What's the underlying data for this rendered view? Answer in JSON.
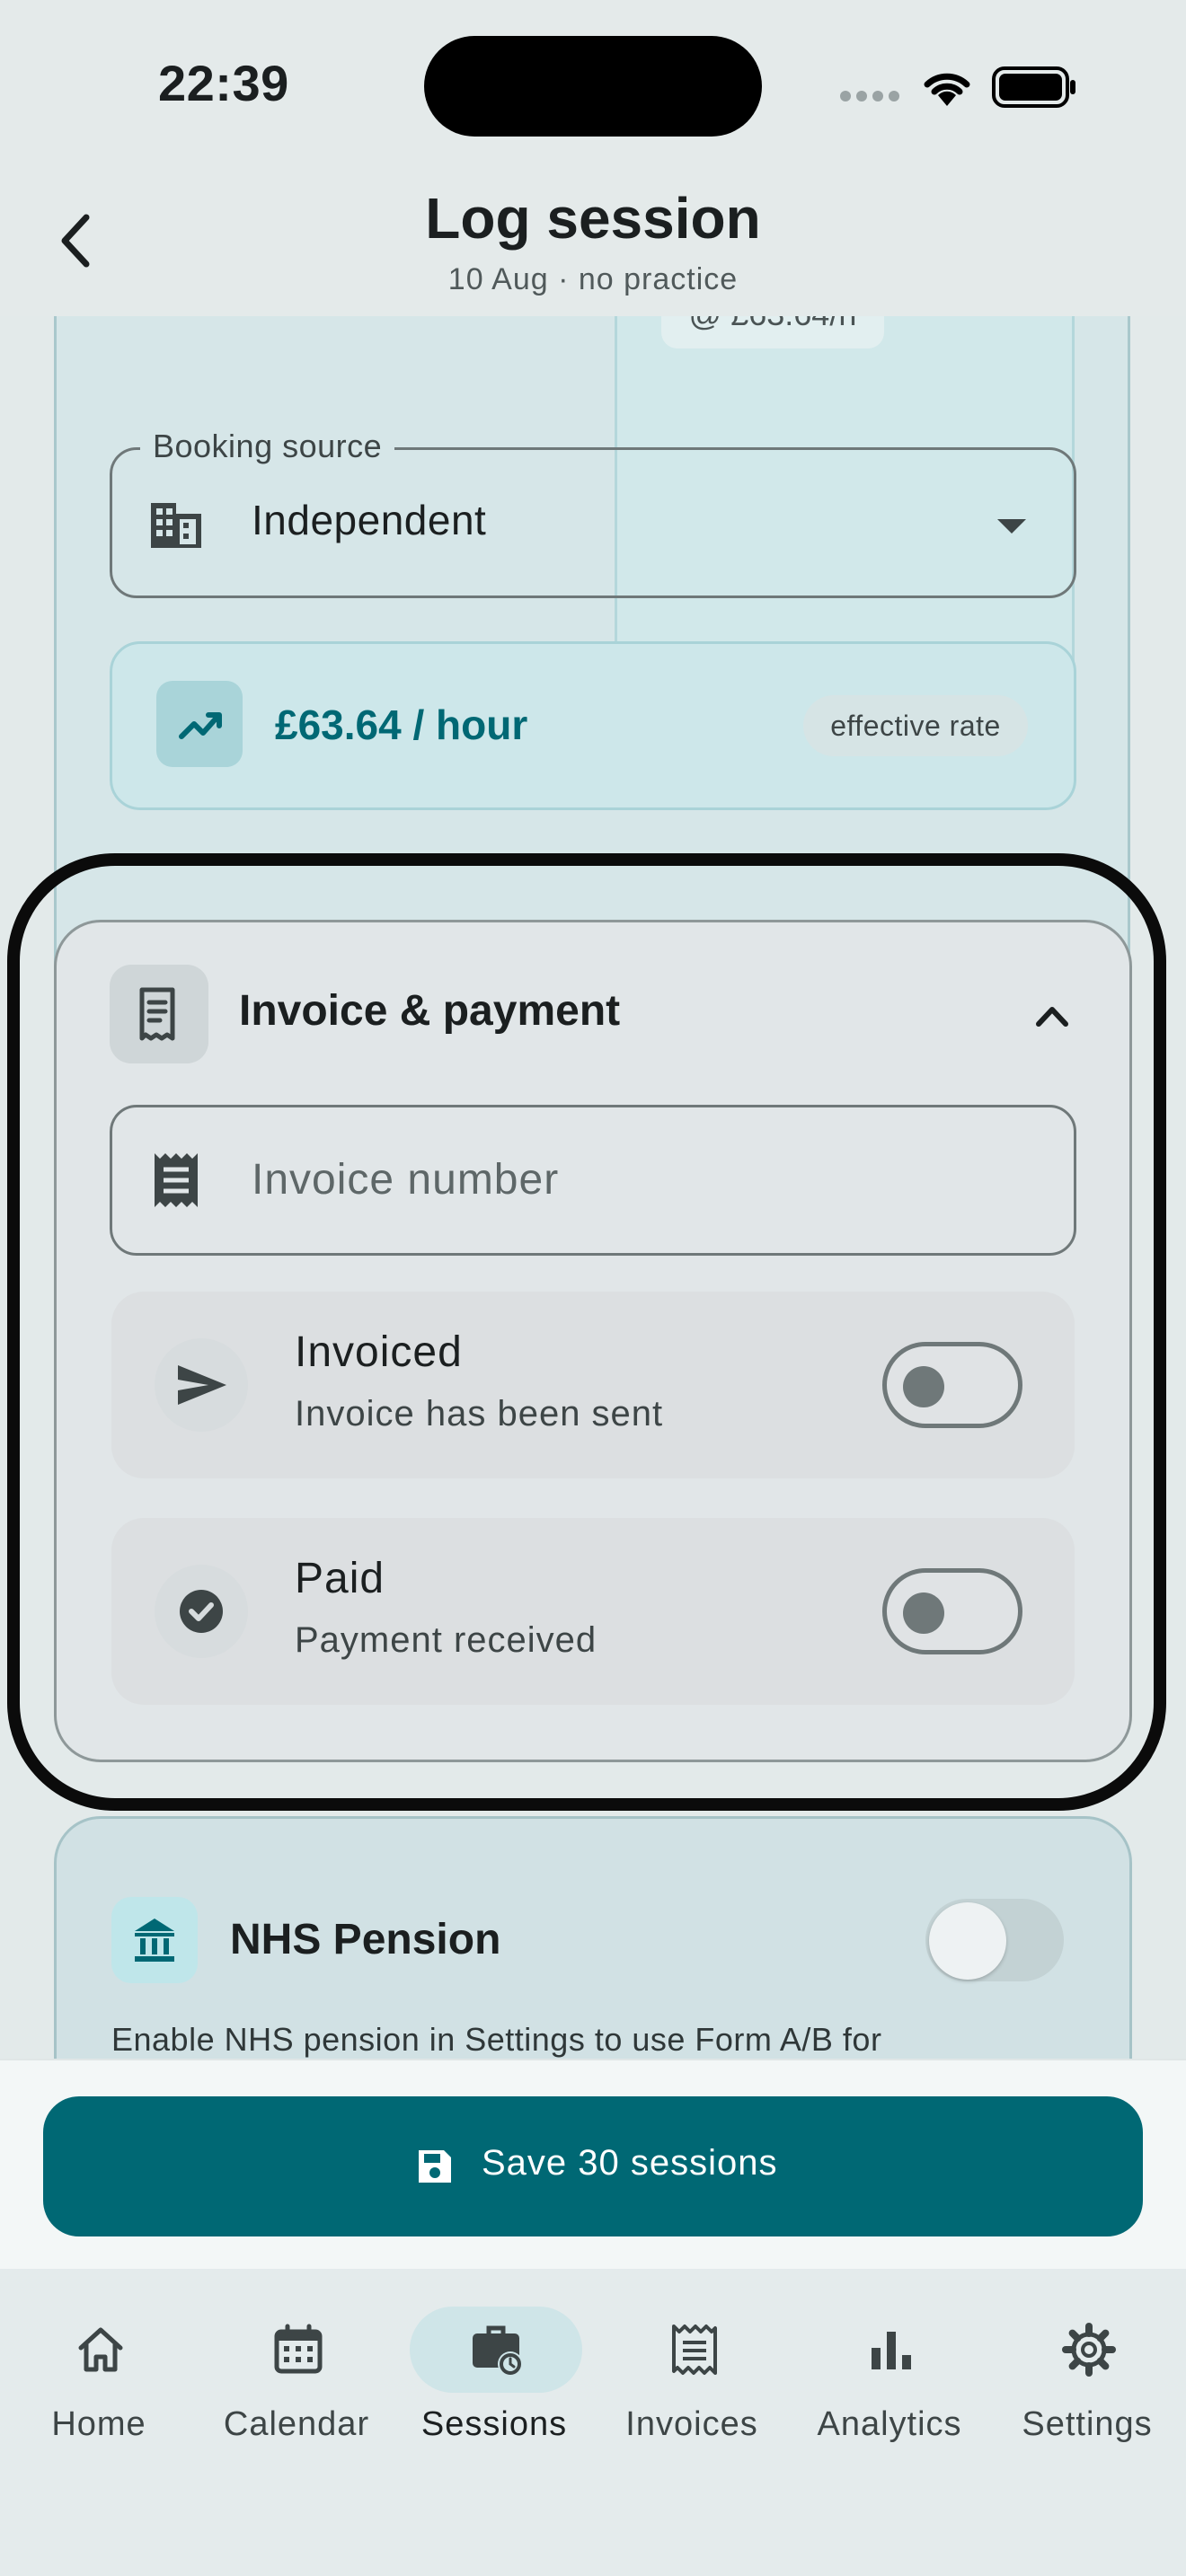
{
  "status_bar": {
    "time": "22:39"
  },
  "header": {
    "title": "Log session",
    "subtitle": "10 Aug · no practice"
  },
  "rate_card": {
    "previous_rate_partial": "@ £63.64/h",
    "booking_source": {
      "label": "Booking source",
      "value": "Independent"
    },
    "effective_rate": {
      "value": "£63.64 / hour",
      "badge": "effective rate"
    }
  },
  "invoice_section": {
    "title": "Invoice & payment",
    "invoice_number": {
      "placeholder": "Invoice number",
      "value": ""
    },
    "invoiced": {
      "title": "Invoiced",
      "subtitle": "Invoice has been sent",
      "enabled": false
    },
    "paid": {
      "title": "Paid",
      "subtitle": "Payment received",
      "enabled": false
    }
  },
  "nhs_pension": {
    "title": "NHS Pension",
    "description": "Enable NHS pension in Settings to use Form A/B for",
    "enabled": false
  },
  "save_button": {
    "label": "Save 30 sessions"
  },
  "bottom_nav": {
    "items": [
      {
        "label": "Home",
        "icon": "home-icon",
        "active": false
      },
      {
        "label": "Calendar",
        "icon": "calendar-icon",
        "active": false
      },
      {
        "label": "Sessions",
        "icon": "sessions-icon",
        "active": true
      },
      {
        "label": "Invoices",
        "icon": "invoices-icon",
        "active": false
      },
      {
        "label": "Analytics",
        "icon": "analytics-icon",
        "active": false
      },
      {
        "label": "Settings",
        "icon": "settings-icon",
        "active": false
      }
    ]
  },
  "colors": {
    "primary": "#006874",
    "background": "#e3eaea",
    "annotation": "#0b0b0b"
  }
}
